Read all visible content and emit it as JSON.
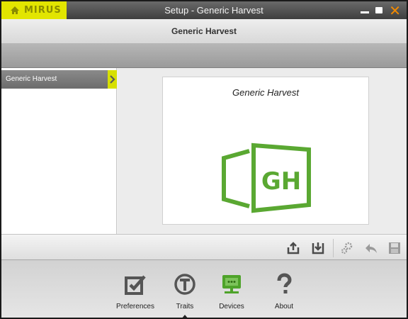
{
  "titlebar": {
    "brand": "MIRUS",
    "title": "Setup - Generic Harvest",
    "close_glyph": "✕"
  },
  "header": {
    "title": "Generic Harvest"
  },
  "sidebar": {
    "items": [
      {
        "label": "Generic Harvest",
        "selected": true
      }
    ]
  },
  "main": {
    "card_title": "Generic Harvest",
    "logo_text": "GH"
  },
  "toolbar": {
    "icons": [
      "export-icon",
      "import-icon",
      "settings-gears-icon",
      "undo-icon",
      "save-icon"
    ]
  },
  "nav": {
    "items": [
      {
        "label": "Preferences",
        "icon": "preferences-icon"
      },
      {
        "label": "Traits",
        "icon": "traits-icon",
        "active": true
      },
      {
        "label": "Devices",
        "icon": "devices-icon"
      },
      {
        "label": "About",
        "icon": "about-icon"
      }
    ]
  },
  "colors": {
    "accent_yellow": "#e2e500",
    "logo_green": "#5aa832",
    "close_orange": "#f28a00"
  }
}
